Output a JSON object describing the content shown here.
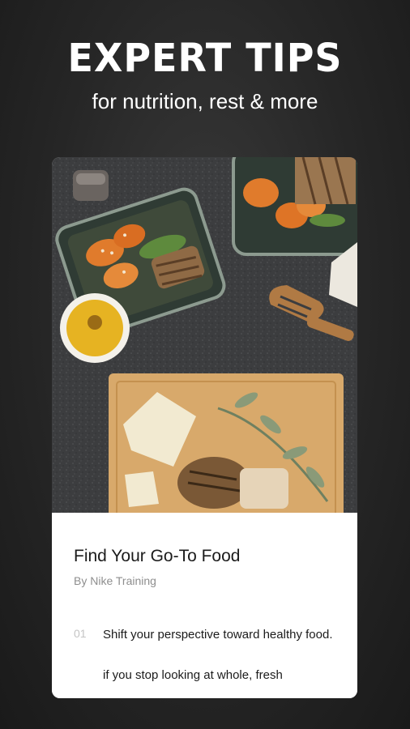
{
  "header": {
    "headline": "EXPERT TIPS",
    "subheadline": "for nutrition, rest & more"
  },
  "card": {
    "image_description_icon": "meal-prep-photo",
    "title": "Find Your Go-To Food",
    "author": "By Nike Training",
    "tip": {
      "number": "01",
      "text": "Shift your perspective toward healthy food.",
      "subtext": "if you stop looking at whole, fresh"
    }
  },
  "colors": {
    "background": "#262626",
    "card_background": "#ffffff",
    "title_text": "#1b1b1b",
    "muted_text": "#8e8e8e"
  }
}
